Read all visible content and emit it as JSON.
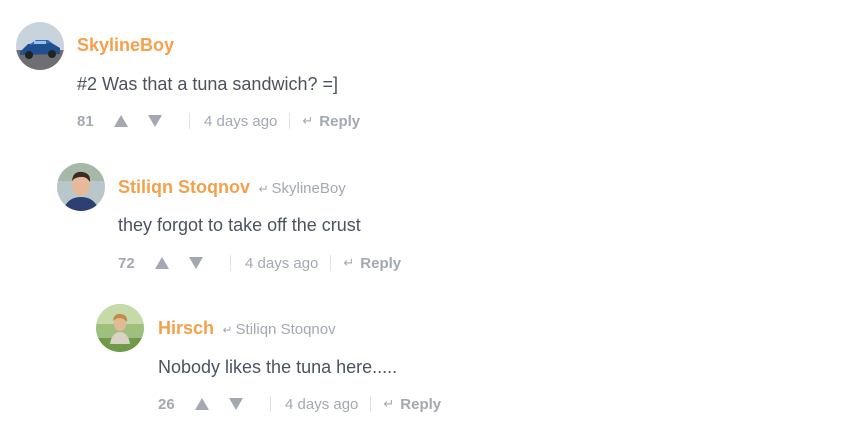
{
  "colors": {
    "author": "#f5a04a",
    "meta": "#a3a8b3",
    "body_text": "#4b5361",
    "separator": "#e1e3e8"
  },
  "comments": [
    {
      "author": "SkylineBoy",
      "reply_to": "",
      "text": "#2 Was that a tuna sandwich? =]",
      "score": "81",
      "time": "4 days ago",
      "reply_label": "Reply",
      "avatar_icon": "car-photo"
    },
    {
      "author": "Stiliqn Stoqnov",
      "reply_to": "SkylineBoy",
      "text": "they forgot to take off the crust",
      "score": "72",
      "time": "4 days ago",
      "reply_label": "Reply",
      "avatar_icon": "person-photo"
    },
    {
      "author": "Hirsch",
      "reply_to": "Stiliqn Stoqnov",
      "text": "Nobody likes the tuna here.....",
      "score": "26",
      "time": "4 days ago",
      "reply_label": "Reply",
      "avatar_icon": "outdoor-photo"
    }
  ]
}
